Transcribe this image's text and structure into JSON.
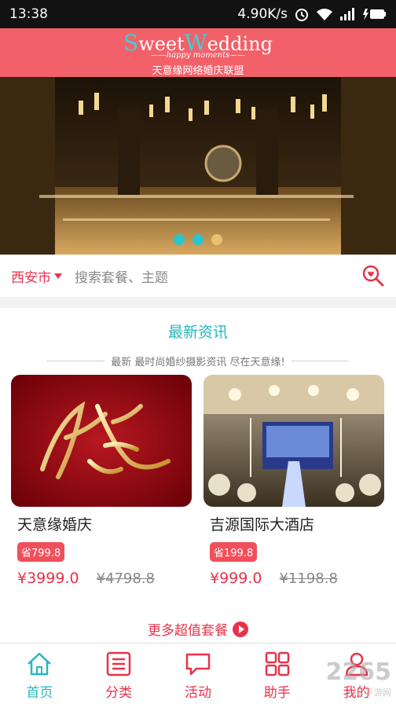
{
  "status": {
    "time": "13:38",
    "speed": "4.90K/s"
  },
  "header": {
    "logo_s": "S",
    "logo_weet": "weet",
    "logo_w": "W",
    "logo_edding": "edding",
    "logo_sub": "happy moments",
    "title_cn": "天意缘网络婚庆联盟"
  },
  "banner": {
    "slides": 3,
    "active_index": 0
  },
  "search": {
    "city": "西安市",
    "placeholder": "搜索套餐、主题"
  },
  "news": {
    "title": "最新资讯",
    "subtitle": "最新 最时尚婚纱摄影资讯 尽在天意缘!"
  },
  "cards": [
    {
      "name": "天意缘婚庆",
      "save": "省799.8",
      "price": "¥3999.0",
      "old_price": "¥4798.8"
    },
    {
      "name": "吉源国际大酒店",
      "save": "省199.8",
      "price": "¥999.0",
      "old_price": "¥1198.8"
    }
  ],
  "more_label": "更多超值套餐",
  "tabs": [
    {
      "label": "首页",
      "icon": "home-icon"
    },
    {
      "label": "分类",
      "icon": "list-icon"
    },
    {
      "label": "活动",
      "icon": "chat-bubble-icon"
    },
    {
      "label": "助手",
      "icon": "grid-icon"
    },
    {
      "label": "我的",
      "icon": "user-icon"
    }
  ],
  "watermark": {
    "text": "2265",
    "small": "手游网"
  },
  "colors": {
    "header": "#f2616a",
    "accent": "#27b7bf",
    "red": "#e8334a"
  }
}
